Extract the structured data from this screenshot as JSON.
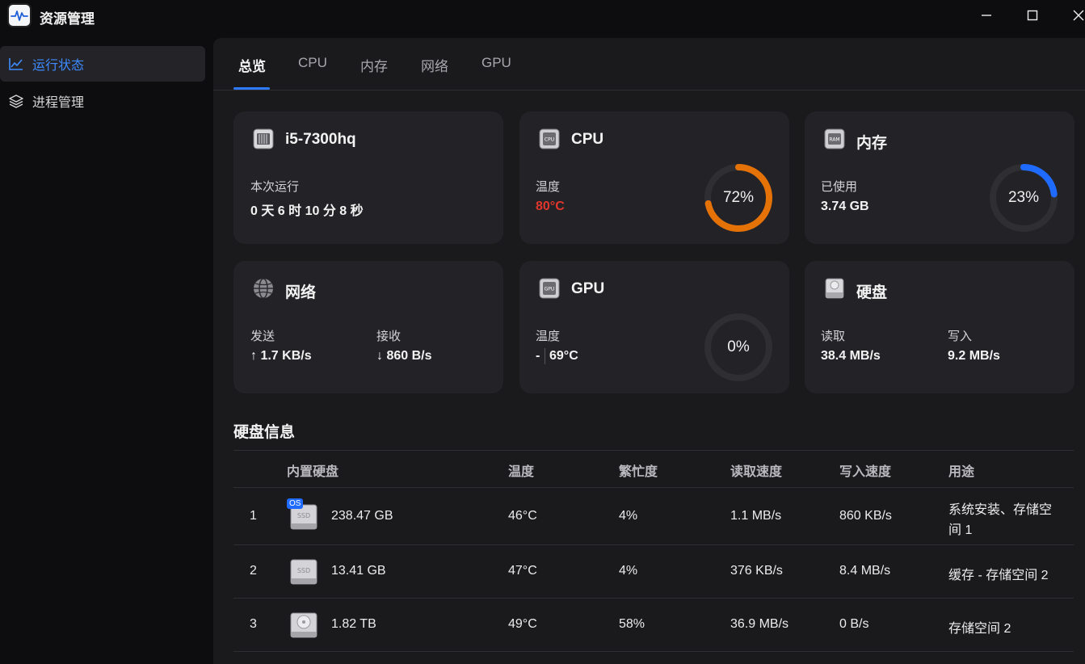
{
  "app": {
    "title": "资源管理"
  },
  "window": {
    "minimize": "—",
    "maximize": "☐",
    "close": "✕"
  },
  "sidebar": {
    "items": [
      {
        "label": "运行状态",
        "icon": "line-chart-icon",
        "active": true
      },
      {
        "label": "进程管理",
        "icon": "layers-icon",
        "active": false
      }
    ]
  },
  "tabs": [
    {
      "label": "总览",
      "active": true
    },
    {
      "label": "CPU"
    },
    {
      "label": "内存"
    },
    {
      "label": "网络"
    },
    {
      "label": "GPU"
    }
  ],
  "cards": {
    "system": {
      "title": "i5-7300hq",
      "uptime_label": "本次运行",
      "uptime_value": "0 天 6 时 10 分 8 秒"
    },
    "cpu": {
      "title": "CPU",
      "chip_text": "CPU",
      "temp_label": "温度",
      "temp_value": "80°C",
      "usage_percent": 72,
      "usage_text": "72%",
      "ring_color": "#e57207"
    },
    "memory": {
      "title": "内存",
      "chip_text": "RAM",
      "used_label": "已使用",
      "used_value": "3.74 GB",
      "usage_percent": 23,
      "usage_text": "23%",
      "ring_color": "#1f6bff"
    },
    "network": {
      "title": "网络",
      "send_label": "发送",
      "send_value": "↑ 1.7 KB/s",
      "recv_label": "接收",
      "recv_value": "↓ 860 B/s"
    },
    "gpu": {
      "title": "GPU",
      "chip_text": "GPU",
      "temp_label": "温度",
      "temp_value_1": "-",
      "temp_value_2": "69°C",
      "usage_percent": 0,
      "usage_text": "0%",
      "ring_color": "#1f6bff"
    },
    "disk": {
      "title": "硬盘",
      "read_label": "读取",
      "read_value": "38.4 MB/s",
      "write_label": "写入",
      "write_value": "9.2 MB/s"
    }
  },
  "disk_section": {
    "title": "硬盘信息",
    "columns": [
      "内置硬盘",
      "温度",
      "繁忙度",
      "读取速度",
      "写入速度",
      "用途"
    ],
    "rows": [
      {
        "index": "1",
        "badge": "OS",
        "type": "SSD",
        "size": "238.47 GB",
        "temp": "46°C",
        "busy": "4%",
        "read": "1.1 MB/s",
        "write": "860 KB/s",
        "usage_line1": "系统安装、存储空",
        "usage_line2": "间 1"
      },
      {
        "index": "2",
        "badge": "",
        "type": "SSD",
        "size": "13.41 GB",
        "temp": "47°C",
        "busy": "4%",
        "read": "376 KB/s",
        "write": "8.4 MB/s",
        "usage_line1": "缓存 - 存储空间 2",
        "usage_line2": ""
      },
      {
        "index": "3",
        "badge": "",
        "type": "HDD",
        "size": "1.82 TB",
        "temp": "49°C",
        "busy": "58%",
        "read": "36.9 MB/s",
        "write": "0 B/s",
        "usage_line1": "存储空间 2",
        "usage_line2": ""
      }
    ]
  }
}
